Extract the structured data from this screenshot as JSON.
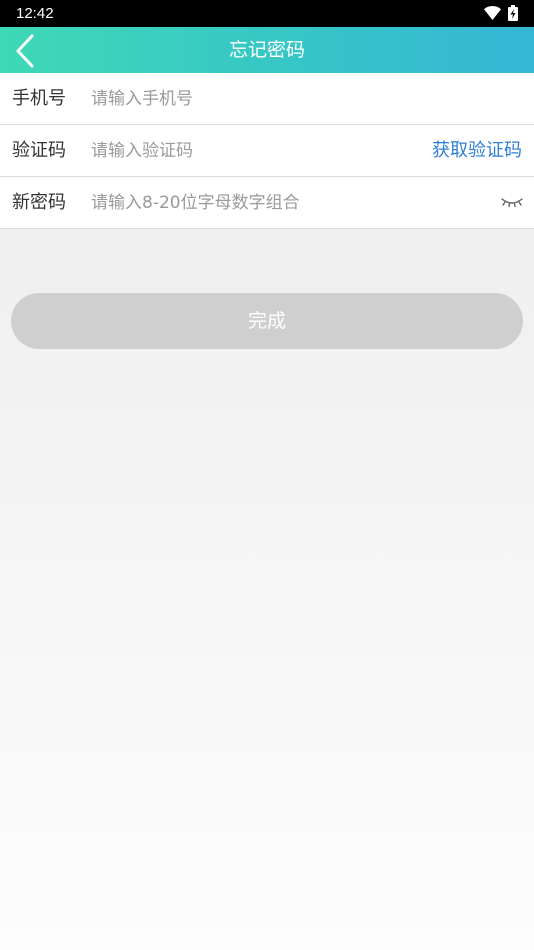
{
  "status_bar": {
    "time": "12:42",
    "icons": [
      "wifi-icon",
      "battery-charging-icon"
    ]
  },
  "nav": {
    "title": "忘记密码",
    "back_icon": "chevron-left-icon"
  },
  "form": {
    "phone": {
      "label": "手机号",
      "placeholder": "请输入手机号",
      "value": ""
    },
    "code": {
      "label": "验证码",
      "placeholder": "请输入验证码",
      "value": "",
      "action_label": "获取验证码"
    },
    "new_password": {
      "label": "新密码",
      "placeholder": "请输入8-20位字母数字组合",
      "value": "",
      "toggle_icon": "eye-closed-icon"
    }
  },
  "submit": {
    "label": "完成"
  },
  "colors": {
    "header_gradient_start": "#3ed9b6",
    "header_gradient_end": "#34b6d5",
    "link": "#2f7fd6",
    "button_disabled": "#cfcfcf"
  }
}
